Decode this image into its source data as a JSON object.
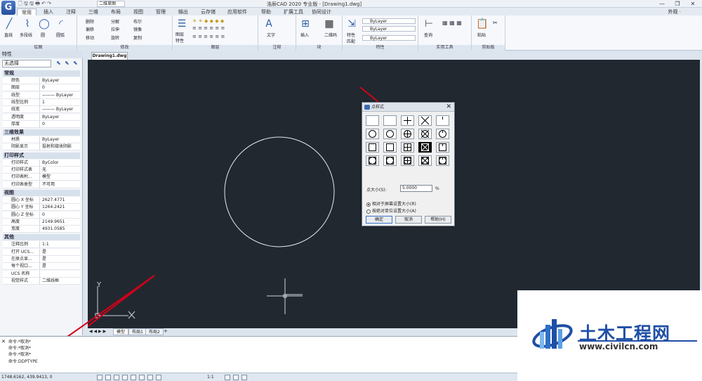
{
  "titlebar": {
    "workspace": "二维草图",
    "window_title": "浩辰CAD 2020 专业版 - [Drawing1.dwg]",
    "controls": [
      "—",
      "❐",
      "✕"
    ]
  },
  "menus": [
    "常用",
    "插入",
    "注释",
    "三维",
    "布局",
    "视图",
    "管理",
    "输出",
    "云存储",
    "应用软件",
    "帮助",
    "扩展工具",
    "协同设计"
  ],
  "appearance_label": "外观 ·",
  "ribbon": {
    "groups": [
      "绘图",
      "修改",
      "图层",
      "注释",
      "块",
      "特性",
      "实用工具",
      "剪贴板"
    ],
    "draw_tools": [
      "直线",
      "多段线",
      "圆",
      "圆弧"
    ],
    "modify_tools": [
      "删除",
      "分解",
      "布尔",
      "偏移",
      "拉伸",
      "镜像",
      "移动",
      "旋转",
      "复制"
    ],
    "layer_tool": "图层\n特性",
    "annotation_tool": "文字",
    "block_tools": [
      "插入",
      "二维码"
    ],
    "match_tool": "特性\n匹配",
    "bylayer": "ByLayer",
    "util_tools": [
      "查询"
    ],
    "clip_tools": [
      "粘贴"
    ]
  },
  "properties": {
    "title": "特性",
    "selection": "无选择",
    "sections": [
      {
        "name": "常规",
        "rows": [
          [
            "颜色",
            "ByLayer"
          ],
          [
            "图层",
            "0"
          ],
          [
            "线型",
            "——— ByLayer"
          ],
          [
            "线型比例",
            "1"
          ],
          [
            "线宽",
            "——— ByLayer"
          ],
          [
            "透明度",
            "ByLayer"
          ],
          [
            "厚度",
            "0"
          ]
        ]
      },
      {
        "name": "三维效果",
        "rows": [
          [
            "材质",
            "ByLayer"
          ],
          [
            "阴影显示",
            "投射和接收阴影"
          ]
        ]
      },
      {
        "name": "打印样式",
        "rows": [
          [
            "打印样式",
            "ByColor"
          ],
          [
            "打印样式表",
            "无"
          ],
          [
            "打印表附...",
            "模型"
          ],
          [
            "打印表类型",
            "不可用"
          ]
        ]
      },
      {
        "name": "视图",
        "rows": [
          [
            "圆心 X 坐标",
            "2627.4771"
          ],
          [
            "圆心 Y 坐标",
            "1264.2421"
          ],
          [
            "圆心 Z 坐标",
            "0"
          ],
          [
            "高度",
            "2149.9651"
          ],
          [
            "宽度",
            "4931.0585"
          ]
        ]
      },
      {
        "name": "其他",
        "rows": [
          [
            "注释比例",
            "1:1"
          ],
          [
            "打开 UCS...",
            "是"
          ],
          [
            "在原点显...",
            "是"
          ],
          [
            "每个视口...",
            "是"
          ],
          [
            "UCS 名称",
            ""
          ],
          [
            "视觉样式",
            "二维线框"
          ]
        ]
      }
    ]
  },
  "doc_tab": "Drawing1.dwg",
  "layout_tabs": [
    "模型",
    "布局1",
    "布局2"
  ],
  "canvas": {
    "y_label": "Y",
    "x_label": "X"
  },
  "command_lines": [
    "命令:*取消*",
    "命令:*取消*",
    "命令:*取消*",
    "命令:DDPTYPE"
  ],
  "coords": "1748.6162, 439.9413, 0",
  "status_scale": "1:1",
  "dialog": {
    "title": "点样式",
    "size_label": "点大小(S):",
    "size_value": "5.0000",
    "size_unit": "%",
    "radio_relative": "相对于屏幕设置大小(R)",
    "radio_absolute": "按绝对单位设置大小(A)",
    "ok": "确定",
    "cancel": "取消",
    "help": "帮助(H)",
    "selected_style_index": 13
  },
  "watermark": {
    "title": "土木工程网",
    "url": "www.civilcn.com"
  },
  "colors": {
    "canvas": "#212830",
    "arrow": "#d0021b",
    "accent": "#1f4fa6"
  }
}
